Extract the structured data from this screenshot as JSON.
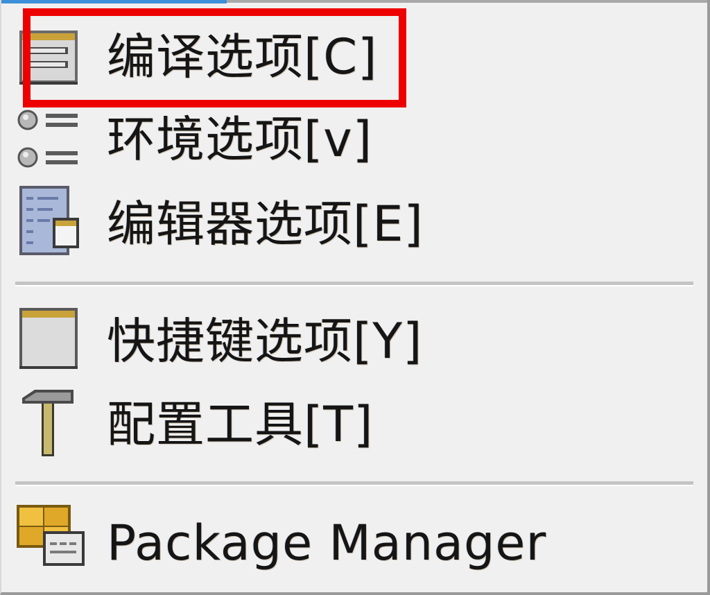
{
  "menu": {
    "items": [
      {
        "label": "编译选项[C]",
        "icon": "compiler-options-icon"
      },
      {
        "label": "环境选项[v]",
        "icon": "environment-options-icon"
      },
      {
        "label": "编辑器选项[E]",
        "icon": "editor-options-icon"
      },
      {
        "label": "快捷键选项[Y]",
        "icon": "shortcut-options-icon"
      },
      {
        "label": "配置工具[T]",
        "icon": "hammer-icon"
      },
      {
        "label": "Package Manager",
        "icon": "package-manager-icon"
      }
    ],
    "highlight_color": "#ee0000",
    "accent_color": "#3c8fd8"
  }
}
